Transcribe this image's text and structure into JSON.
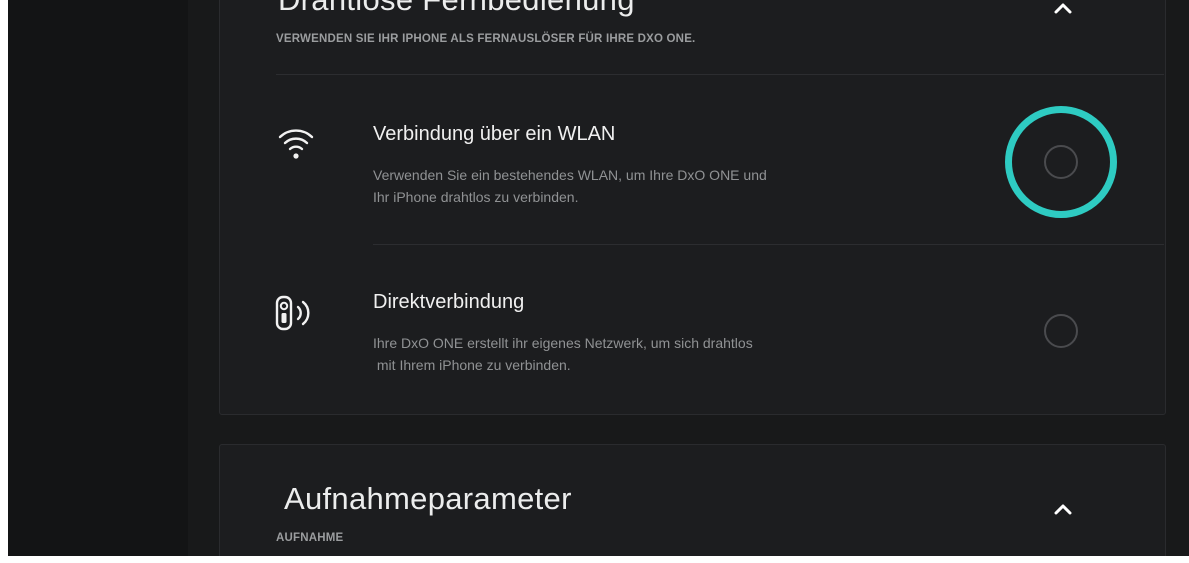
{
  "remote_section": {
    "title": "Drahtlose Fernbedienung",
    "subtitle": "VERWENDEN SIE IHR IPHONE ALS FERNAUSLÖSER FÜR IHRE DXO ONE.",
    "collapse_icon": "chevron-up-icon",
    "options": [
      {
        "icon": "wifi-icon",
        "title": "Verbindung über ein WLAN",
        "description_line1": "Verwenden Sie ein bestehendes WLAN, um Ihre DxO ONE und",
        "description_line2": "Ihr iPhone drahtlos zu verbinden.",
        "selected": false,
        "highlighted": true
      },
      {
        "icon": "camera-wireless-icon",
        "title": "Direktverbindung",
        "description_line1": "Ihre DxO ONE erstellt ihr eigenes Netzwerk, um sich drahtlos",
        "description_line2": " mit Ihrem iPhone zu verbinden.",
        "selected": false,
        "highlighted": false
      }
    ]
  },
  "capture_section": {
    "title": "Aufnahmeparameter",
    "subtitle": "AUFNAHME",
    "collapse_icon": "chevron-up-icon"
  },
  "colors": {
    "background": "#151617",
    "card": "#1c1d1f",
    "highlight_ring": "#2ecbc2",
    "text_primary": "#f0f0f0",
    "text_secondary": "#909294"
  }
}
